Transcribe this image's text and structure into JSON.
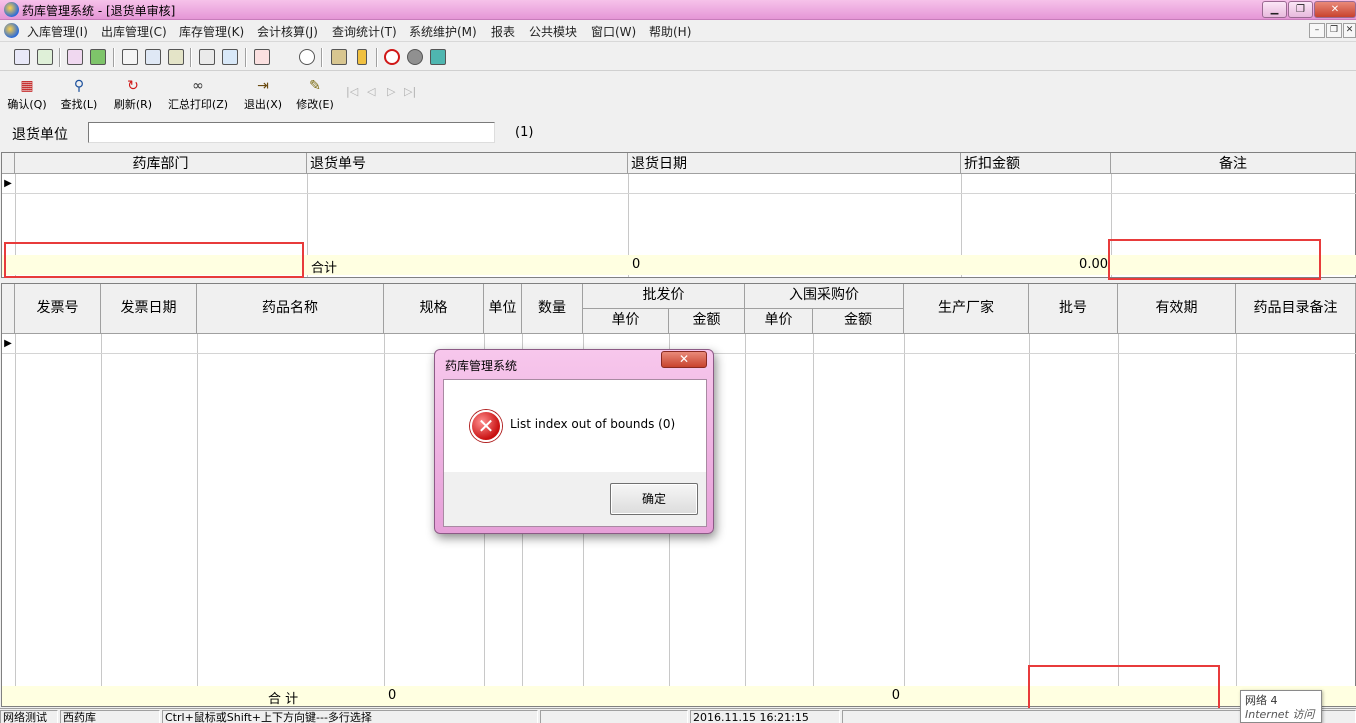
{
  "window": {
    "title": "药库管理系统 - [退货单审核]",
    "controls": [
      "▁",
      "❐",
      "✕"
    ]
  },
  "menu": {
    "items": [
      "入库管理(I)",
      "出库管理(C)",
      "库存管理(K)",
      "会计核算(J)",
      "查询统计(T)",
      "系统维护(M)",
      "报表",
      "公共模块",
      "窗口(W)",
      "帮助(H)"
    ],
    "mdi_controls": [
      "–",
      "❐",
      "✕"
    ]
  },
  "toolbar": {
    "actions": [
      "确认(Q)",
      "查找(L)",
      "刷新(R)",
      "汇总打印(Z)",
      "退出(X)",
      "修改(E)"
    ],
    "nav": [
      "|◁",
      "◁",
      "▷",
      "▷|"
    ]
  },
  "supplier": {
    "label": "退货单位",
    "value": "",
    "count": "(1)"
  },
  "upper_grid": {
    "headers": [
      "药库部门",
      "退货单号",
      "退货日期",
      "折扣金额",
      "备注"
    ],
    "total_label": "合计",
    "total_date": "0",
    "total_amount": "0.00"
  },
  "lower_grid": {
    "headers": {
      "invoice_no": "发票号",
      "invoice_date": "发票日期",
      "drug_name": "药品名称",
      "spec": "规格",
      "unit": "单位",
      "qty": "数量",
      "wholesale": "批发价",
      "wholesale_unit": "单价",
      "wholesale_amount": "金额",
      "purchase": "入围采购价",
      "purchase_unit": "单价",
      "purchase_amount": "金额",
      "maker": "生产厂家",
      "batch": "批号",
      "expiry": "有效期",
      "catalog_note": "药品目录备注"
    },
    "total_label": "合   计",
    "total_spec": "0",
    "total_purchase_amount": "0"
  },
  "dialog": {
    "title": "药库管理系统",
    "message": "List index out of bounds (0)",
    "ok_label": "确定",
    "close": "✕",
    "icon": "error-icon"
  },
  "statusbar": {
    "panels": [
      "网络测试",
      "西药库",
      "Ctrl+鼠标或Shift+上下方向键---多行选择",
      "",
      "2016.11.15 16:21:15",
      ""
    ]
  },
  "tooltip": {
    "line1": "网络  4",
    "line2": "Internet 访问"
  },
  "colors": {
    "title_gradient_top": "#f6c2ea",
    "title_gradient_bottom": "#e596d6",
    "total_row": "#ffffe1",
    "highlight_box": "#e83b3b"
  }
}
